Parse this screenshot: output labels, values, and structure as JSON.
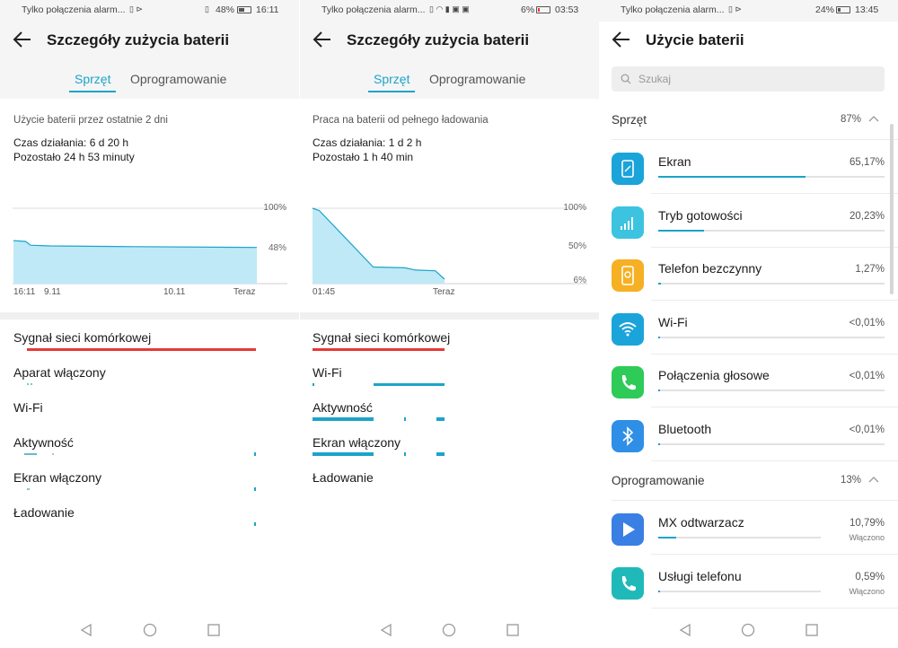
{
  "screen1": {
    "status": {
      "left": "Tylko połączenia alarm...",
      "battery": "48%",
      "time": "16:11"
    },
    "title": "Szczegóły zużycia baterii",
    "tabs": [
      {
        "label": "Sprzęt",
        "active": true
      },
      {
        "label": "Oprogramowanie",
        "active": false
      }
    ],
    "description": "Użycie baterii przez ostatnie 2 dni",
    "runtime": "Czas działania: 6 d 20 h",
    "remaining": "Pozostało 24 h 53 minuty",
    "chart_data": {
      "type": "area",
      "x": [
        "16:11",
        "9.11",
        "10.11",
        "Teraz"
      ],
      "y_ticks": [
        "100%",
        "48%"
      ],
      "values": [
        {
          "x": 0,
          "y": 57
        },
        {
          "x": 0.05,
          "y": 56
        },
        {
          "x": 0.07,
          "y": 51
        },
        {
          "x": 0.15,
          "y": 50
        },
        {
          "x": 0.5,
          "y": 49
        },
        {
          "x": 1,
          "y": 48
        }
      ],
      "ylim": [
        0,
        100
      ]
    },
    "signals": [
      {
        "label": "Sygnał sieci komórkowej"
      },
      {
        "label": "Aparat włączony"
      },
      {
        "label": "Wi-Fi"
      },
      {
        "label": "Aktywność"
      },
      {
        "label": "Ekran włączony"
      },
      {
        "label": "Ładowanie"
      }
    ]
  },
  "screen2": {
    "status": {
      "left": "Tylko połączenia alarm...",
      "battery": "6%",
      "time": "03:53"
    },
    "title": "Szczegóły zużycia baterii",
    "tabs": [
      {
        "label": "Sprzęt",
        "active": true
      },
      {
        "label": "Oprogramowanie",
        "active": false
      }
    ],
    "description": "Praca na baterii od pełnego ładowania",
    "runtime": "Czas działania: 1 d 2 h",
    "remaining": "Pozostało 1 h 40 min",
    "chart_data": {
      "type": "area",
      "x": [
        "01:45",
        "Teraz"
      ],
      "y_ticks": [
        "100%",
        "50%",
        "6%"
      ],
      "values": [
        {
          "x": 0,
          "y": 100
        },
        {
          "x": 0.05,
          "y": 97
        },
        {
          "x": 0.46,
          "y": 22
        },
        {
          "x": 0.7,
          "y": 21
        },
        {
          "x": 0.78,
          "y": 18
        },
        {
          "x": 0.93,
          "y": 17
        },
        {
          "x": 1,
          "y": 6
        }
      ],
      "ylim": [
        0,
        100
      ]
    },
    "signals": [
      {
        "label": "Sygnał sieci komórkowej"
      },
      {
        "label": "Wi-Fi"
      },
      {
        "label": "Aktywność"
      },
      {
        "label": "Ekran włączony"
      },
      {
        "label": "Ładowanie"
      }
    ]
  },
  "screen3": {
    "status": {
      "left": "Tylko połączenia alarm...",
      "battery": "24%",
      "time": "13:45"
    },
    "title": "Użycie baterii",
    "search_placeholder": "Szukaj",
    "hardware": {
      "label": "Sprzęt",
      "percent": "87%"
    },
    "software": {
      "label": "Oprogramowanie",
      "percent": "13%"
    },
    "hardware_items": [
      {
        "name": "Ekran",
        "value": "65,17%",
        "level": 0.6517,
        "icon": "screen-icon",
        "color": "#1ba4d9"
      },
      {
        "name": "Tryb gotowości",
        "value": "20,23%",
        "level": 0.2023,
        "icon": "signal-icon",
        "color": "#3cc3df"
      },
      {
        "name": "Telefon bezczynny",
        "value": "1,27%",
        "level": 0.0127,
        "icon": "idle-phone-icon",
        "color": "#f6b024"
      },
      {
        "name": "Wi-Fi",
        "value": "<0,01%",
        "level": 0.0001,
        "icon": "wifi-icon",
        "color": "#1ba4d9"
      },
      {
        "name": "Połączenia głosowe",
        "value": "<0,01%",
        "level": 0.0001,
        "icon": "phone-call-icon",
        "color": "#2ecb58"
      },
      {
        "name": "Bluetooth",
        "value": "<0,01%",
        "level": 0.0001,
        "icon": "bluetooth-icon",
        "color": "#2f8fe6"
      }
    ],
    "software_items": [
      {
        "name": "MX odtwarzacz",
        "value": "10,79%",
        "sub": "Włączono",
        "level": 0.1079,
        "icon": "play-icon",
        "color": "#3a7fe3"
      },
      {
        "name": "Usługi telefonu",
        "value": "0,59%",
        "sub": "Włączono",
        "level": 0.0059,
        "icon": "phone-service-icon",
        "color": "#20b9b9"
      }
    ]
  },
  "colors": {
    "accent": "#1ba4c9",
    "cellular": "#e53935",
    "chart_fill": "#bfe9f6"
  }
}
